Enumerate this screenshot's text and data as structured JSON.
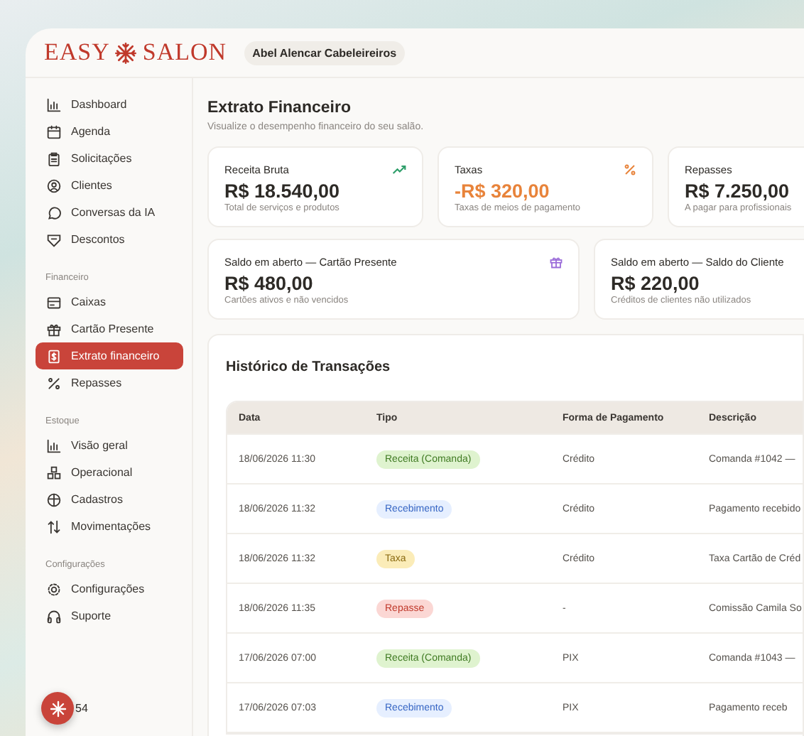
{
  "brand": {
    "left": "EASY",
    "right": "SALON"
  },
  "salon_badge": "Abel Alencar Cabeleireiros",
  "sidebar": {
    "sections": [
      {
        "items": [
          {
            "label": "Dashboard",
            "selected": false
          },
          {
            "label": "Agenda",
            "selected": false
          },
          {
            "label": "Solicitações",
            "selected": false
          },
          {
            "label": "Clientes",
            "selected": false
          },
          {
            "label": "Conversas da IA",
            "selected": false
          },
          {
            "label": "Descontos",
            "selected": false
          }
        ]
      },
      {
        "heading": "Financeiro",
        "items": [
          {
            "label": "Caixas",
            "selected": false
          },
          {
            "label": "Cartão Presente",
            "selected": false
          },
          {
            "label": "Extrato financeiro",
            "selected": true
          },
          {
            "label": "Repasses",
            "selected": false
          }
        ]
      },
      {
        "heading": "Estoque",
        "items": [
          {
            "label": "Visão geral",
            "selected": false
          },
          {
            "label": "Operacional",
            "selected": false
          },
          {
            "label": "Cadastros",
            "selected": false
          },
          {
            "label": "Movimentações",
            "selected": false
          }
        ]
      },
      {
        "heading": "Configurações",
        "items": [
          {
            "label": "Configurações",
            "selected": false
          },
          {
            "label": "Suporte",
            "selected": false
          }
        ]
      }
    ]
  },
  "fab_badge": "54",
  "page": {
    "title": "Extrato Financeiro",
    "subtitle": "Visualize o desempenho financeiro do seu salão."
  },
  "stats": [
    {
      "label": "Receita Bruta",
      "value": "R$ 18.540,00",
      "caption": "Total de serviços e produtos",
      "kind": "income"
    },
    {
      "label": "Taxas",
      "value": "-R$ 320,00",
      "caption": "Taxas de meios de pagamento",
      "kind": "expense"
    },
    {
      "label": "Repasses",
      "value": "R$ 7.250,00",
      "caption": "A pagar para profissionais",
      "kind": "neutral"
    }
  ],
  "balances": [
    {
      "label": "Saldo em aberto — Cartão Presente",
      "value": "R$ 480,00",
      "caption": "Cartões ativos e não vencidos"
    },
    {
      "label": "Saldo em aberto — Saldo do Cliente",
      "value": "R$ 220,00",
      "caption": "Créditos de clientes não utilizados"
    }
  ],
  "transactions": {
    "title": "Histórico de Transações",
    "columns": [
      "Data",
      "Tipo",
      "Forma de Pagamento",
      "Descrição"
    ],
    "rows": [
      {
        "date": "18/06/2026 11:30",
        "type": "Receita (Comanda)",
        "kind": "receita",
        "payment": "Crédito",
        "description": "Comanda #1042 —"
      },
      {
        "date": "18/06/2026 11:32",
        "type": "Recebimento",
        "kind": "recebimento",
        "payment": "Crédito",
        "description": "Pagamento recebido"
      },
      {
        "date": "18/06/2026 11:32",
        "type": "Taxa",
        "kind": "taxa",
        "payment": "Crédito",
        "description": "Taxa Cartão de Créd"
      },
      {
        "date": "18/06/2026 11:35",
        "type": "Repasse",
        "kind": "repasse",
        "payment": "-",
        "description": "Comissão Camila So"
      },
      {
        "date": "17/06/2026 07:00",
        "type": "Receita (Comanda)",
        "kind": "receita",
        "payment": "PIX",
        "description": "Comanda #1043 —"
      },
      {
        "date": "17/06/2026 07:03",
        "type": "Recebimento",
        "kind": "recebimento",
        "payment": "PIX",
        "description": "Pagamento receb"
      }
    ]
  }
}
